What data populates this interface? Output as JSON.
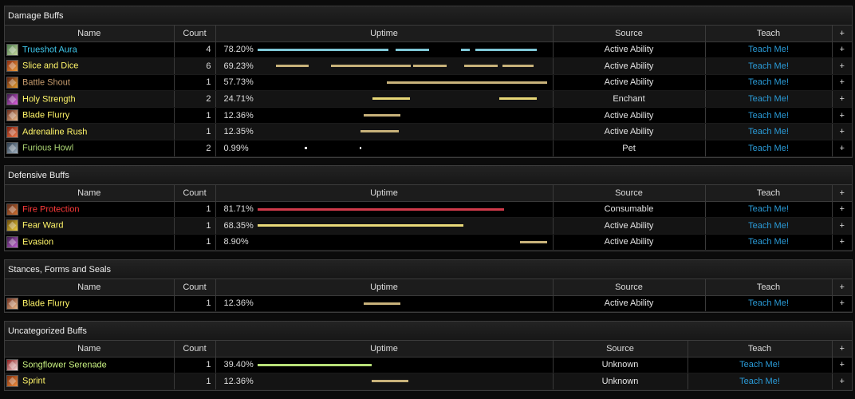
{
  "columns": {
    "name": "Name",
    "count": "Count",
    "uptime": "Uptime",
    "source": "Source",
    "teach": "Teach",
    "plus": "+"
  },
  "sections": [
    {
      "title": "Damage Buffs",
      "rows": [
        {
          "name": "Trueshot Aura",
          "color": "#3fc7eb",
          "icon": "trueshot-aura-icon",
          "iconColors": [
            "#4a7a4a",
            "#c8d8a0"
          ],
          "count": "4",
          "uptime": "78.20%",
          "source": "Active Ability",
          "teach": "Teach Me!",
          "plus": "+",
          "barColor": "#7fc7d6",
          "bars": [
            [
              0,
              0.452
            ],
            [
              0.478,
              0.593
            ],
            [
              0.702,
              0.731
            ],
            [
              0.75,
              0.962
            ]
          ]
        },
        {
          "name": "Slice and Dice",
          "color": "#fff569",
          "icon": "slice-and-dice-icon",
          "iconColors": [
            "#8a2a10",
            "#f0a040"
          ],
          "count": "6",
          "uptime": "69.23%",
          "source": "Active Ability",
          "teach": "Teach Me!",
          "plus": "+",
          "barColor": "#c8b27a",
          "bars": [
            [
              0.065,
              0.176
            ],
            [
              0.254,
              0.53
            ],
            [
              0.537,
              0.652
            ],
            [
              0.713,
              0.829
            ],
            [
              0.844,
              0.953
            ]
          ]
        },
        {
          "name": "Battle Shout",
          "color": "#c79c6e",
          "icon": "battle-shout-icon",
          "iconColors": [
            "#5a1a0a",
            "#e8a030"
          ],
          "count": "1",
          "uptime": "57.73%",
          "source": "Active Ability",
          "teach": "Teach Me!",
          "plus": "+",
          "barColor": "#c8b27a",
          "bars": [
            [
              0.446,
              1.0
            ]
          ]
        },
        {
          "name": "Holy Strength",
          "color": "#fff569",
          "icon": "holy-strength-icon",
          "iconColors": [
            "#3a1a4a",
            "#e060e0"
          ],
          "count": "2",
          "uptime": "24.71%",
          "source": "Enchant",
          "teach": "Teach Me!",
          "plus": "+",
          "barColor": "#e8d878",
          "bars": [
            [
              0.398,
              0.527
            ],
            [
              0.835,
              0.962
            ]
          ]
        },
        {
          "name": "Blade Flurry",
          "color": "#fff569",
          "icon": "blade-flurry-icon",
          "iconColors": [
            "#6a2a1a",
            "#f0c090"
          ],
          "count": "1",
          "uptime": "12.36%",
          "source": "Active Ability",
          "teach": "Teach Me!",
          "plus": "+",
          "barColor": "#c8b27a",
          "bars": [
            [
              0.366,
              0.493
            ]
          ]
        },
        {
          "name": "Adrenaline Rush",
          "color": "#fff569",
          "icon": "adrenaline-rush-icon",
          "iconColors": [
            "#7a1a0a",
            "#f08050"
          ],
          "count": "1",
          "uptime": "12.35%",
          "source": "Active Ability",
          "teach": "Teach Me!",
          "plus": "+",
          "barColor": "#c8b27a",
          "bars": [
            [
              0.357,
              0.487
            ]
          ]
        },
        {
          "name": "Furious Howl",
          "color": "#abd473",
          "icon": "furious-howl-icon",
          "iconColors": [
            "#2a3a4a",
            "#a0b0c0"
          ],
          "count": "2",
          "uptime": "0.99%",
          "source": "Pet",
          "teach": "Teach Me!",
          "plus": "+",
          "barColor": "#e6e6e6",
          "bars": [
            [
              0.163,
              0.171
            ],
            [
              0.354,
              0.357
            ]
          ]
        }
      ]
    },
    {
      "title": "Defensive Buffs",
      "rows": [
        {
          "name": "Fire Protection",
          "color": "#ff3a3a",
          "icon": "fire-protection-icon",
          "iconColors": [
            "#5a2a1a",
            "#d07030"
          ],
          "count": "1",
          "uptime": "81.71%",
          "source": "Consumable",
          "teach": "Teach Me!",
          "plus": "+",
          "barColor": "#d03a4a",
          "bars": [
            [
              0,
              0.85
            ]
          ]
        },
        {
          "name": "Fear Ward",
          "color": "#fff569",
          "icon": "fear-ward-icon",
          "iconColors": [
            "#6a4a0a",
            "#f0d040"
          ],
          "count": "1",
          "uptime": "68.35%",
          "source": "Active Ability",
          "teach": "Teach Me!",
          "plus": "+",
          "barColor": "#e8d878",
          "bars": [
            [
              0,
              0.71
            ]
          ]
        },
        {
          "name": "Evasion",
          "color": "#fff569",
          "icon": "evasion-icon",
          "iconColors": [
            "#3a1a4a",
            "#c060d0"
          ],
          "count": "1",
          "uptime": "8.90%",
          "source": "Active Ability",
          "teach": "Teach Me!",
          "plus": "+",
          "barColor": "#c8b27a",
          "bars": [
            [
              0.906,
              1.0
            ]
          ]
        }
      ]
    },
    {
      "title": "Stances, Forms and Seals",
      "rows": [
        {
          "name": "Blade Flurry",
          "color": "#fff569",
          "icon": "blade-flurry-icon",
          "iconColors": [
            "#6a2a1a",
            "#f0c090"
          ],
          "count": "1",
          "uptime": "12.36%",
          "source": "Active Ability",
          "teach": "Teach Me!",
          "plus": "+",
          "barColor": "#c8b27a",
          "bars": [
            [
              0.366,
              0.493
            ]
          ]
        }
      ]
    },
    {
      "title": "Uncategorized Buffs",
      "rows": [
        {
          "name": "Songflower Serenade",
          "color": "#c8f080",
          "icon": "songflower-serenade-icon",
          "iconColors": [
            "#8a1a1a",
            "#f8e0e0"
          ],
          "count": "1",
          "uptime": "39.40%",
          "source": "Unknown",
          "teach": "Teach Me!",
          "plus": "+",
          "barColor": "#b8e078",
          "bars": [
            [
              0,
              0.395
            ]
          ]
        },
        {
          "name": "Sprint",
          "color": "#fff569",
          "icon": "sprint-icon",
          "iconColors": [
            "#7a2a0a",
            "#f09040"
          ],
          "count": "1",
          "uptime": "12.36%",
          "source": "Unknown",
          "teach": "Teach Me!",
          "plus": "+",
          "barColor": "#c8b27a",
          "bars": [
            [
              0.394,
              0.52
            ]
          ]
        }
      ]
    }
  ]
}
